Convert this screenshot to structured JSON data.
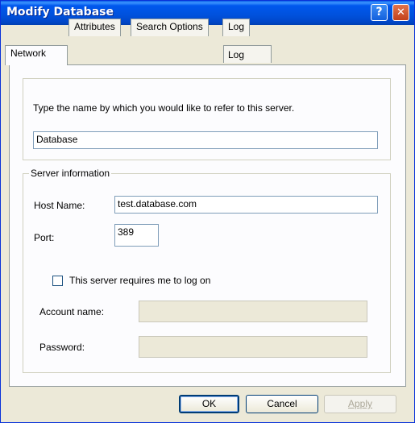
{
  "window": {
    "title": "Modify Database"
  },
  "tabs": [
    {
      "label": "Network"
    },
    {
      "label": "Attributes"
    },
    {
      "label": "Search Options"
    },
    {
      "label": "Log"
    }
  ],
  "name_section": {
    "instruction": "Type the name by which you would like to refer to this server.",
    "name_value": "Database"
  },
  "server_info": {
    "legend": "Server information",
    "host_label": "Host Name:",
    "host_value": "test.database.com",
    "port_label": "Port:",
    "port_value": "389",
    "logon_label": "This server requires me to log on",
    "logon_checked": false,
    "account_label": "Account name:",
    "account_value": "",
    "password_label": "Password:",
    "password_value": ""
  },
  "buttons": {
    "ok": "OK",
    "cancel": "Cancel",
    "apply": "Apply"
  }
}
